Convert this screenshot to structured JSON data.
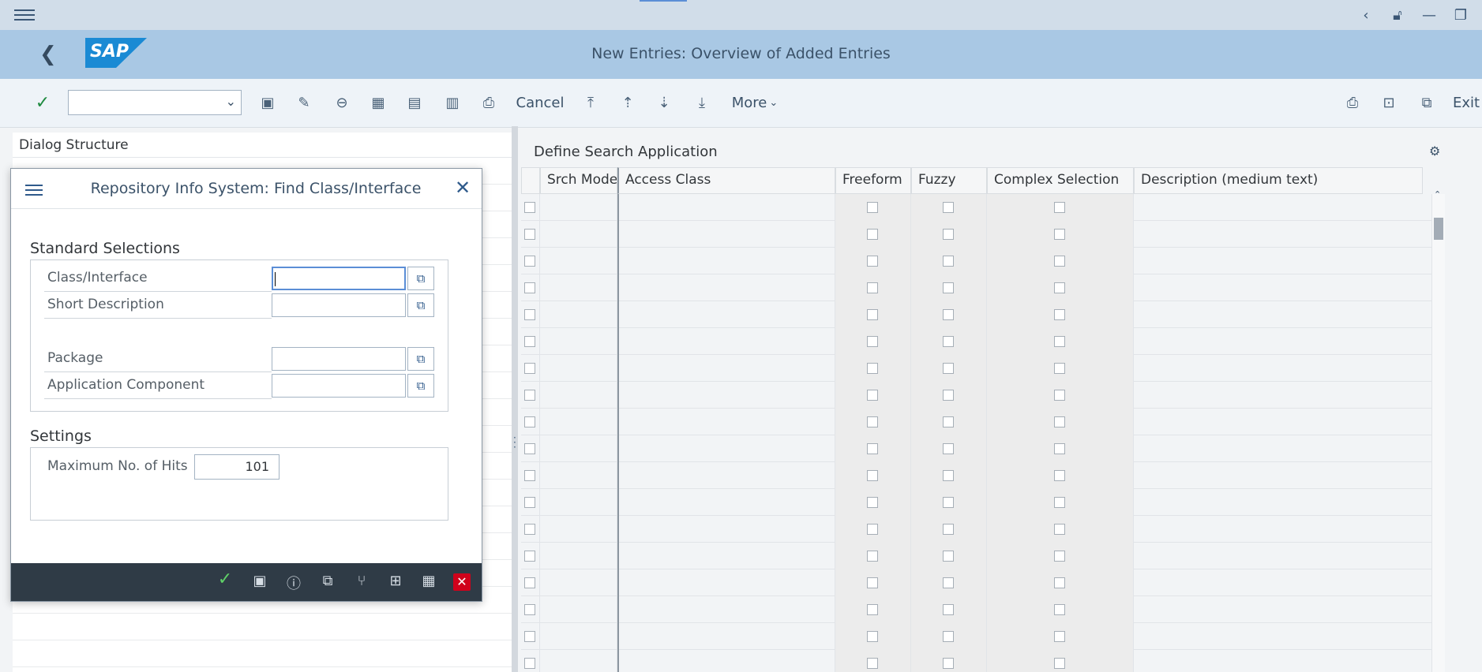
{
  "window": {
    "title": "New Entries: Overview of Added Entries",
    "logo": "SAP"
  },
  "system_icons": [
    "chevron-left-icon",
    "lock-icon",
    "minimize-icon",
    "restore-icon"
  ],
  "toolbar": {
    "combo_value": "",
    "cancel_label": "Cancel",
    "more_label": "More",
    "exit_label": "Exit"
  },
  "left_panel": {
    "header": "Dialog Structure"
  },
  "right_panel": {
    "title": "Define Search Application",
    "columns": [
      "Srch Mode",
      "Access Class",
      "Freeform",
      "Fuzzy",
      "Complex Selection",
      "Description (medium text)"
    ]
  },
  "dialog": {
    "title": "Repository Info System: Find Class/Interface",
    "standard_title": "Standard Selections",
    "fields": [
      {
        "label": "Class/Interface",
        "value": ""
      },
      {
        "label": "Short Description",
        "value": ""
      },
      {
        "label": "Package",
        "value": ""
      },
      {
        "label": "Application Component",
        "value": ""
      }
    ],
    "settings_title": "Settings",
    "max_hits_label": "Maximum No. of Hits",
    "max_hits_value": "101"
  },
  "colors": {
    "title_bar": "#a9c8e4",
    "sap_blue": "#1a8ad4",
    "dialog_footer": "#2f3b46",
    "confirm_green": "#1e8a40",
    "cancel_red": "#d0021b"
  }
}
